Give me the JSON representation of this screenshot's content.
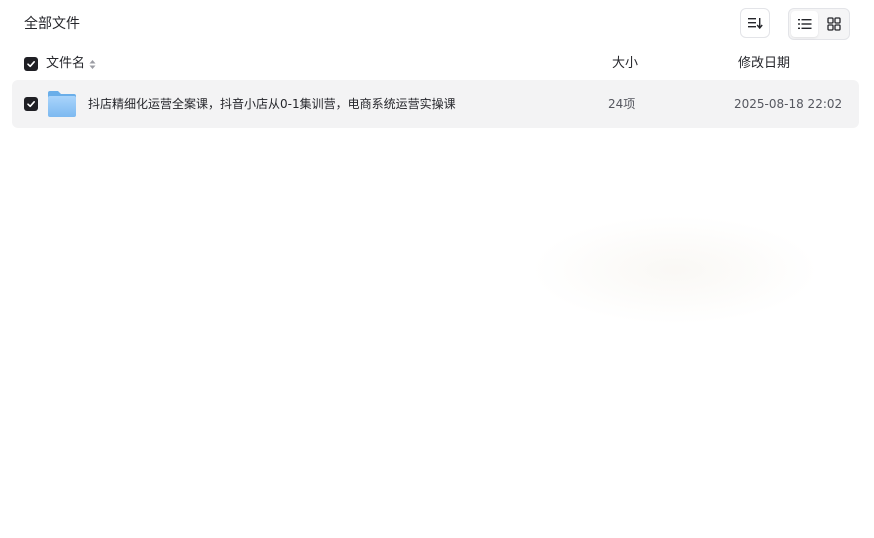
{
  "breadcrumb": {
    "label": "全部文件"
  },
  "toolbar": {
    "sort_icon": "sort-descending-icon",
    "list_view_icon": "list-view-icon",
    "grid_view_icon": "grid-view-icon",
    "active_view": "list"
  },
  "table": {
    "columns": {
      "name": "文件名",
      "size": "大小",
      "date": "修改日期"
    },
    "select_all_checked": true,
    "rows": [
      {
        "checked": true,
        "type_icon": "folder-icon",
        "name": "抖店精细化运营全案课，抖音小店从0-1集训营，电商系统运营实操课",
        "size": "24项",
        "date": "2025-08-18 22:02"
      }
    ]
  },
  "colors": {
    "text_primary": "#25262b",
    "row_selected_bg": "#f3f3f4",
    "checkbox_fill": "#1f1f24",
    "folder_blue": "#8ec5f5"
  }
}
